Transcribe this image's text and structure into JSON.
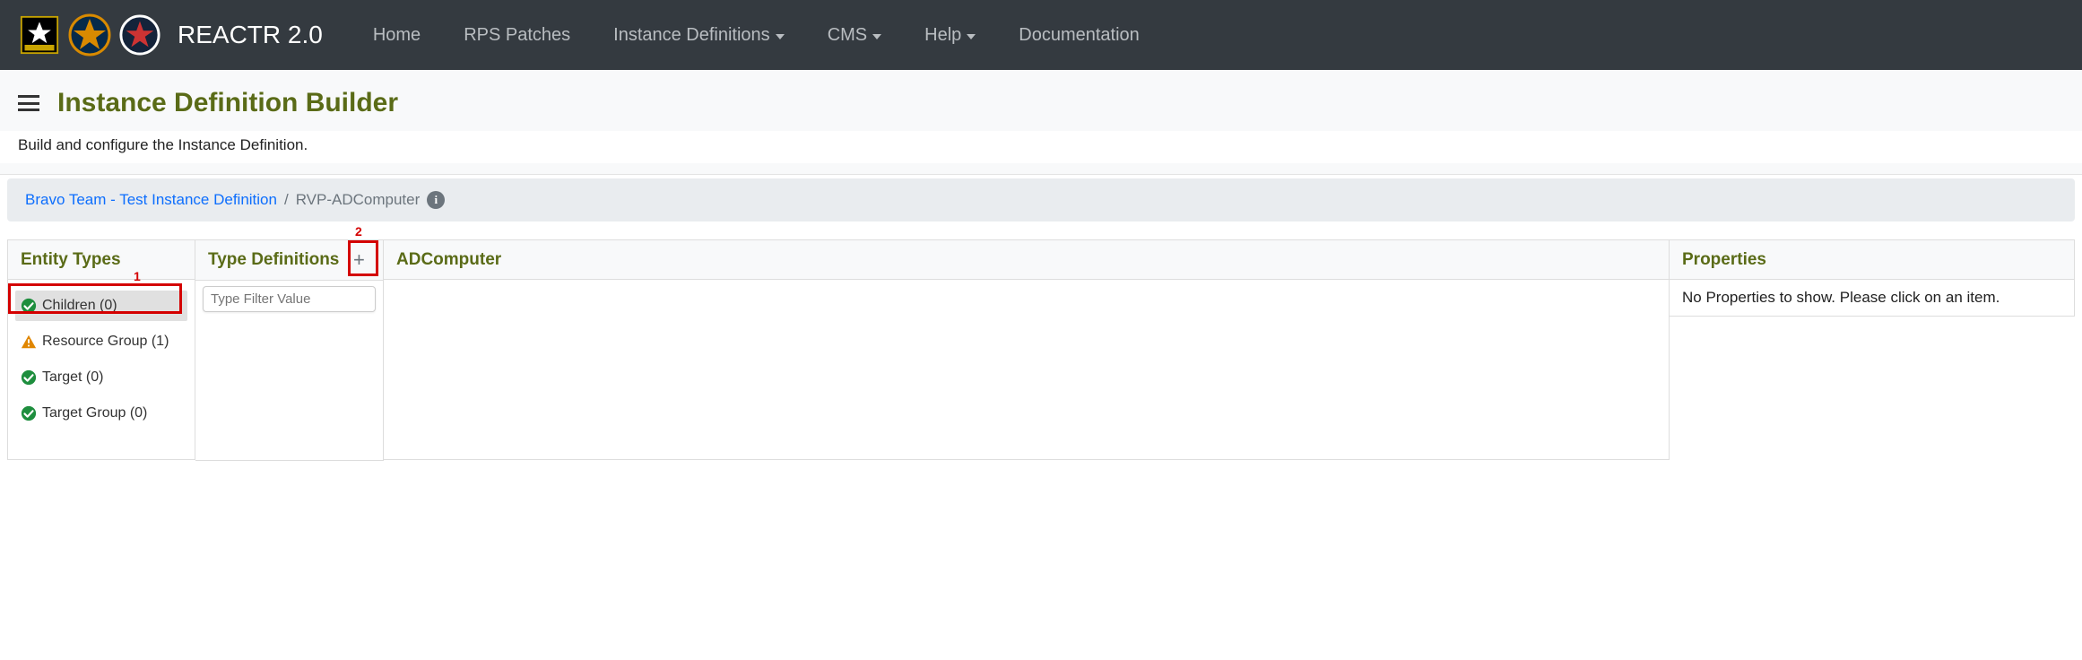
{
  "brand": "REACTR 2.0",
  "nav": {
    "home": "Home",
    "rps_patches": "RPS Patches",
    "instance_defs": "Instance Definitions",
    "cms": "CMS",
    "help": "Help",
    "docs": "Documentation"
  },
  "page": {
    "title": "Instance Definition Builder",
    "subtitle": "Build and configure the Instance Definition."
  },
  "breadcrumb": {
    "link": "Bravo Team - Test Instance Definition",
    "separator": "/",
    "current": "RVP-ADComputer"
  },
  "columns": {
    "entity_header": "Entity Types",
    "type_header": "Type Definitions",
    "main_header": "ADComputer",
    "props_header": "Properties"
  },
  "entity_types": [
    {
      "label": "Children (0)",
      "status": "ok",
      "selected": true
    },
    {
      "label": "Resource Group (1)",
      "status": "warn",
      "selected": false
    },
    {
      "label": "Target (0)",
      "status": "ok",
      "selected": false
    },
    {
      "label": "Target Group (0)",
      "status": "ok",
      "selected": false
    }
  ],
  "type_filter": {
    "placeholder": "Type Filter Value"
  },
  "properties_empty": "No Properties to show. Please click on an item.",
  "callouts": {
    "one": "1",
    "two": "2"
  },
  "icons": {
    "info": "i",
    "plus": "+"
  }
}
